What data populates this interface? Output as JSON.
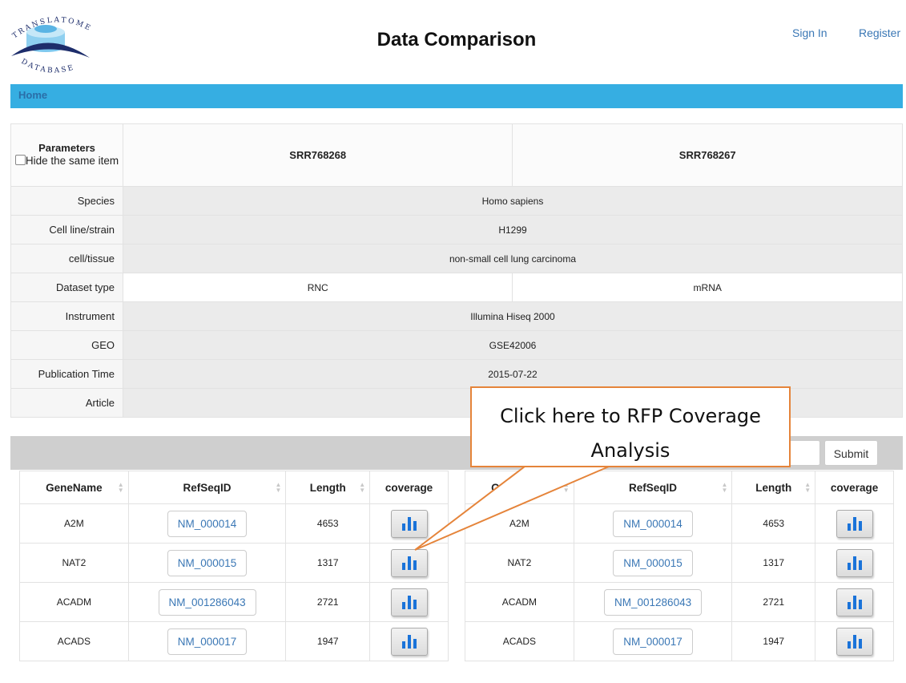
{
  "logo": {
    "top_text": "TRANSLATOME",
    "bottom_text": "DATABASE"
  },
  "header": {
    "title": "Data Comparison",
    "sign_in": "Sign In",
    "register": "Register"
  },
  "nav": {
    "home": "Home"
  },
  "params": {
    "header_label": "Parameters",
    "hide_label": "Hide the same item",
    "samples": [
      "SRR768268",
      "SRR768267"
    ],
    "rows": [
      {
        "label": "Species",
        "value": "Homo sapiens"
      },
      {
        "label": "Cell line/strain",
        "value": "H1299"
      },
      {
        "label": "cell/tissue",
        "value": "non-small cell lung carcinoma"
      },
      {
        "label": "Dataset type",
        "value_a": "RNC",
        "value_b": "mRNA"
      },
      {
        "label": "Instrument",
        "value": "Illumina Hiseq 2000"
      },
      {
        "label": "GEO",
        "value": "GSE42006"
      },
      {
        "label": "Publication Time",
        "value": "2015-07-22"
      },
      {
        "label": "Article",
        "value": ""
      }
    ]
  },
  "search": {
    "submit": "Submit"
  },
  "gene_table": {
    "columns": [
      "GeneName",
      "RefSeqID",
      "Length",
      "coverage"
    ],
    "rows": [
      {
        "gene": "A2M",
        "refseq": "NM_000014",
        "length": "4653"
      },
      {
        "gene": "NAT2",
        "refseq": "NM_000015",
        "length": "1317"
      },
      {
        "gene": "ACADM",
        "refseq": "NM_001286043",
        "length": "2721"
      },
      {
        "gene": "ACADS",
        "refseq": "NM_000017",
        "length": "1947"
      }
    ]
  },
  "callout": {
    "line1": "Click here to RFP Coverage",
    "line2": "Analysis"
  },
  "colors": {
    "nav_bar": "#36aee2",
    "link": "#3a77b5",
    "callout_border": "#e5843a",
    "bar_icon": "#1a73d9"
  }
}
